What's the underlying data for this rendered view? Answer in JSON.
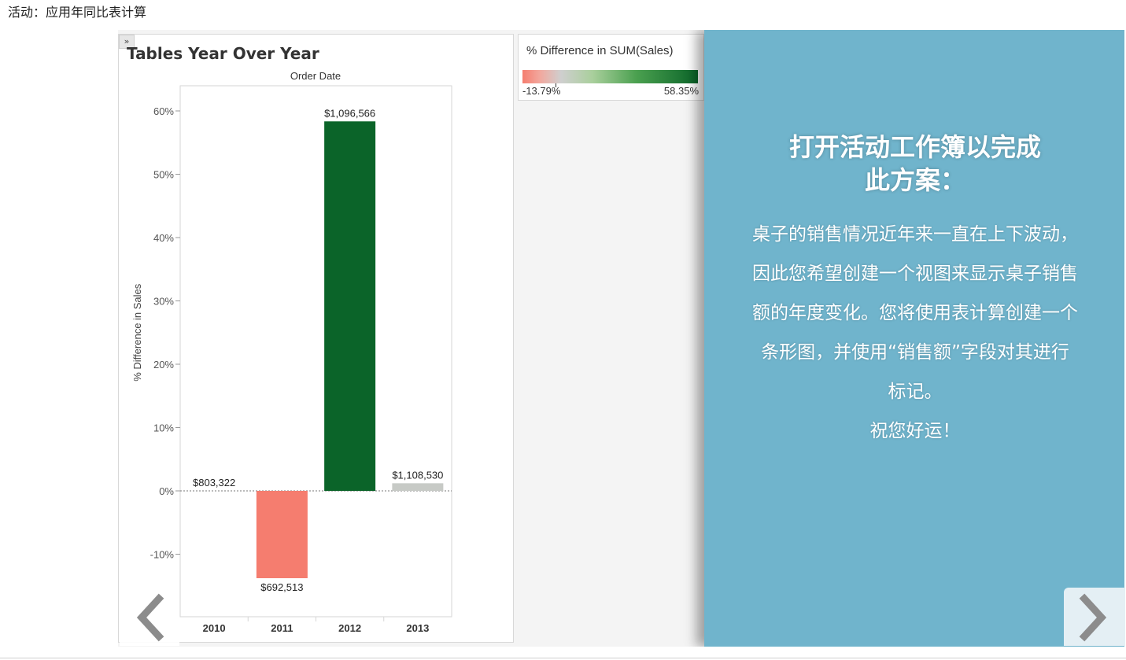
{
  "page": {
    "title": "活动：应用年同比表计算"
  },
  "worksheet": {
    "expand_label": "»",
    "title": "Tables Year Over Year",
    "column_header": "Order Date",
    "y_axis_label": "% Difference in Sales"
  },
  "chart_data": {
    "type": "bar",
    "title": "Tables Year Over Year",
    "xlabel": "Order Date",
    "ylabel": "% Difference in Sales",
    "categories": [
      "2010",
      "2011",
      "2012",
      "2013"
    ],
    "values": [
      0,
      -13.79,
      58.35,
      1.2
    ],
    "data_labels": [
      "$803,322",
      "$692,513",
      "$1,096,566",
      "$1,108,530"
    ],
    "colors": [
      "#cccccc",
      "#f57d6f",
      "#0b6429",
      "#c7cac6"
    ],
    "ylim": [
      -16,
      64
    ],
    "yticks": [
      -10,
      0,
      10,
      20,
      30,
      40,
      50,
      60
    ],
    "ytick_labels": [
      "-10%",
      "0%",
      "10%",
      "20%",
      "30%",
      "40%",
      "50%",
      "60%"
    ],
    "grid": false,
    "zero_line": "dotted"
  },
  "legend": {
    "title": "% Difference in SUM(Sales)",
    "min_label": "-13.79%",
    "max_label": "58.35%",
    "color_low": "#f57d6f",
    "color_mid": "#cfcfcf",
    "color_high": "#0b6429"
  },
  "story": {
    "heading_line1": "打开活动工作簿以完成",
    "heading_line2": "此方案：",
    "body_lines": [
      "桌子的销售情况近年来一直在上下波动，",
      "因此您希望创建一个视图来显示桌子销售",
      "额的年度变化。您将使用表计算创建一个",
      "条形图，并使用“销售额”字段对其进行",
      "标记。",
      "祝您好运！"
    ],
    "background": "#70b4cc"
  },
  "navigation": {
    "prev_icon": "chevron-left-icon",
    "next_icon": "chevron-right-icon"
  }
}
